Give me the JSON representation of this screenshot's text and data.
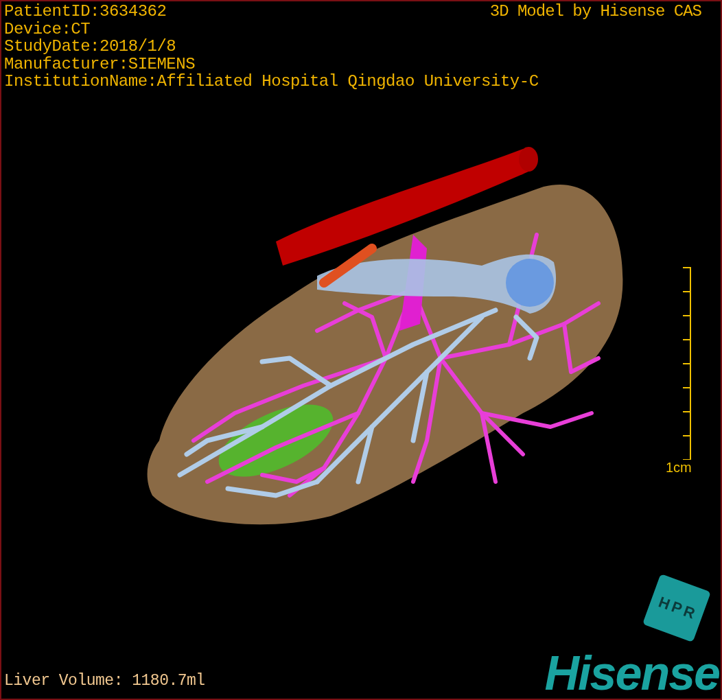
{
  "info_lines": [
    "PatientID:3634362",
    "Device:CT",
    "StudyDate:2018/1/8",
    "Manufacturer:SIEMENS",
    "InstitutionName:Affiliated Hospital Qingdao University-C"
  ],
  "credit": "3D Model by Hisense CAS",
  "scale_bar": {
    "label": "1cm"
  },
  "orientation_cube": {
    "labels": [
      "H",
      "P",
      "R"
    ]
  },
  "liver_volume": "Liver Volume: 1180.7ml",
  "logo": "Hisense"
}
